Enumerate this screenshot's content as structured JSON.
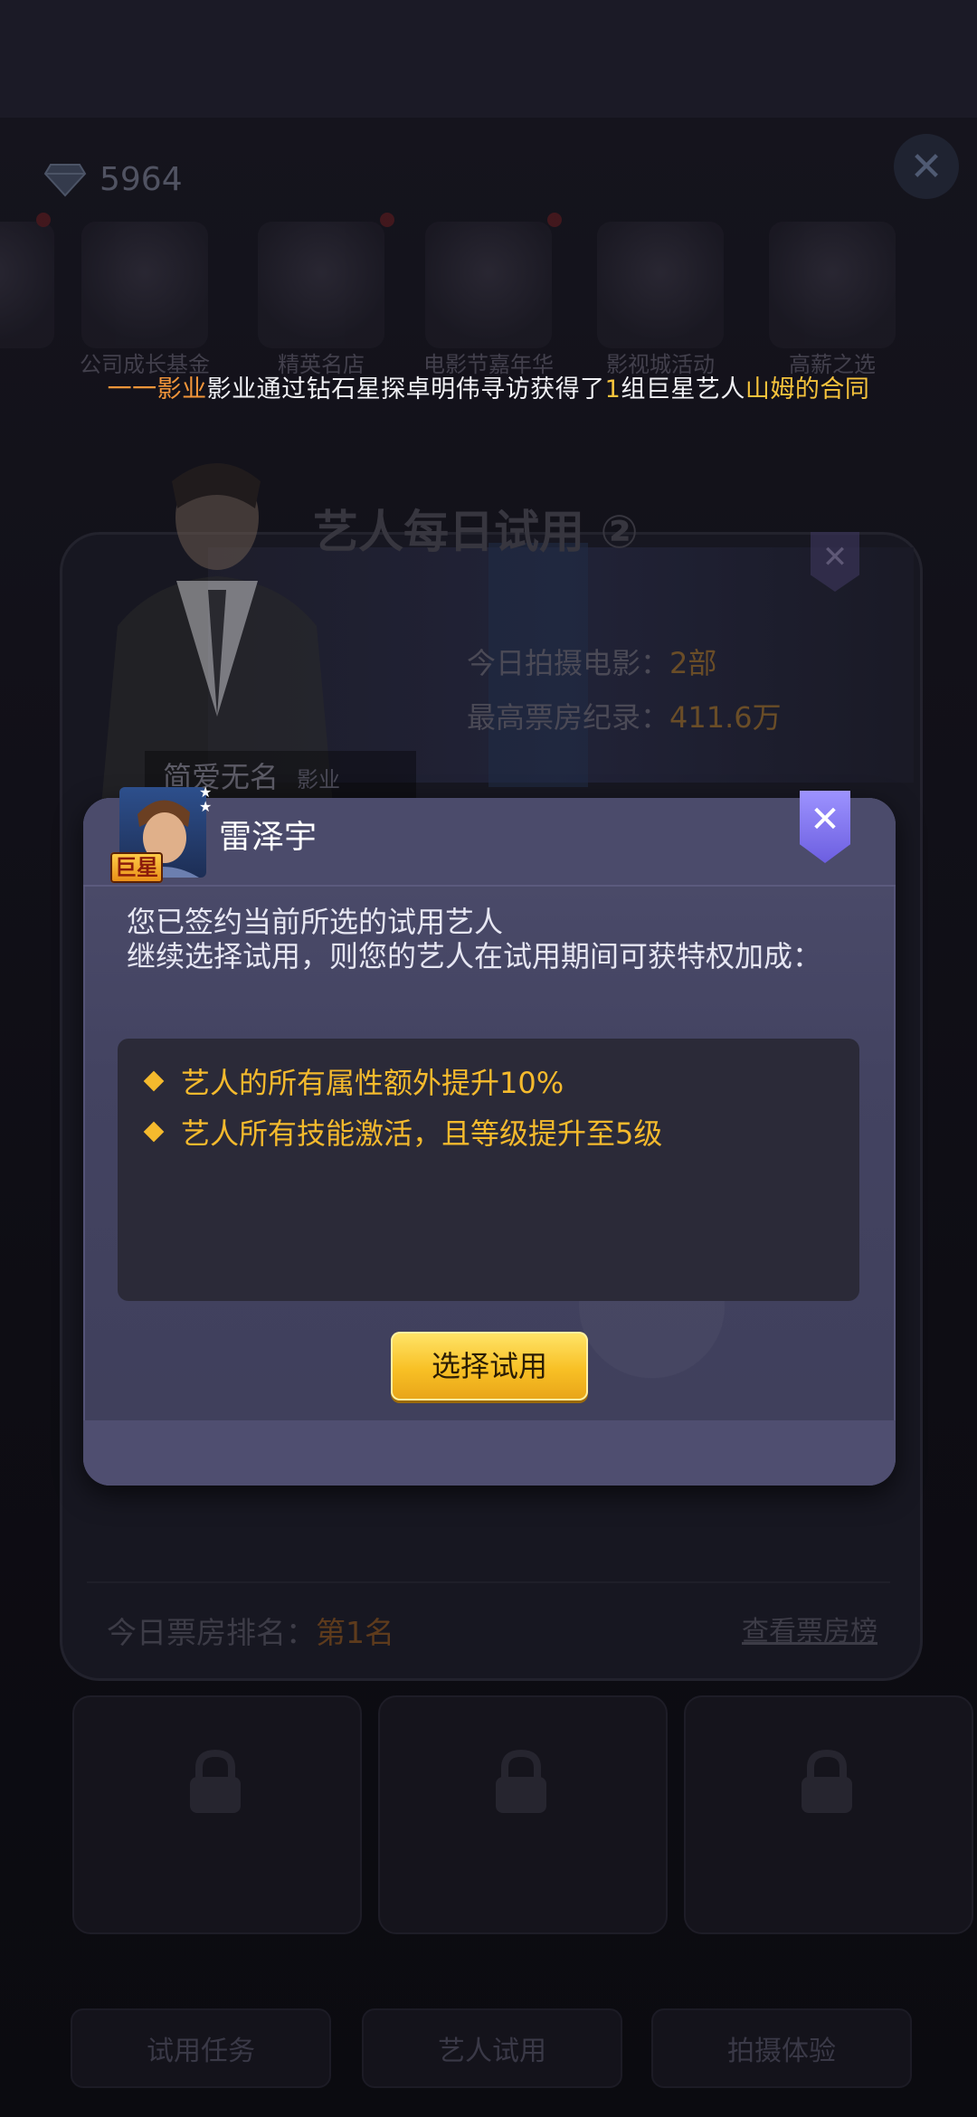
{
  "top": {
    "diamond_count": "5964"
  },
  "bg_icons": [
    {
      "label": ""
    },
    {
      "label": "公司成长基金"
    },
    {
      "label": "精英名店"
    },
    {
      "label": "电影节嘉年华"
    },
    {
      "label": "影视城活动"
    },
    {
      "label": "高薪之选"
    }
  ],
  "ticker": {
    "part1": "一一影业",
    "part2": "影业通过钻石星探卓明伟寻访获得了",
    "part3": "1",
    "part4": "组巨星艺人",
    "part5": "山姆的合同"
  },
  "underlying": {
    "title": "艺人每日试用 ②",
    "stat1_label": "今日拍摄电影：",
    "stat1_value": "2部",
    "stat2_label": "最高票房纪录：",
    "stat2_value": "411.6万",
    "artist_name": "简爱无名",
    "artist_tag": "影业",
    "rank_label": "今日票房排名：",
    "rank_value": "第1名",
    "rank_link": "查看票房榜",
    "tabs": [
      "试用任务",
      "艺人试用",
      "拍摄体验"
    ]
  },
  "modal": {
    "badge": "巨星",
    "name": "雷泽宇",
    "desc_line1": "您已签约当前所选的试用艺人",
    "desc_line2": "继续选择试用，则您的艺人在试用期间可获特权加成：",
    "benefits": [
      "艺人的所有属性额外提升10%",
      "艺人所有技能激活，且等级提升至5级"
    ],
    "button": "选择试用"
  },
  "colors": {
    "accent_gold": "#f5ba2d",
    "ticker_orange": "#f2953a",
    "modal_bg": "#45456a"
  }
}
